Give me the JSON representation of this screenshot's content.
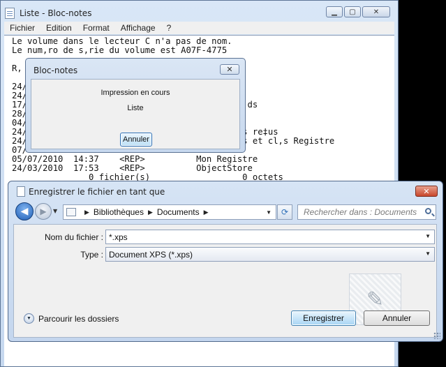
{
  "notepad": {
    "title": "Liste - Bloc-notes",
    "menu": [
      "Fichier",
      "Edition",
      "Format",
      "Affichage",
      "?"
    ],
    "content": "Le volume dans le lecteur C n'a pas de nom.\nLe num,ro de s,rie du volume est A07F-4775\n\nR,\n\n24/0\n24/0\n17/0                                          ds\n28/0\n04/0\n24/0                                     hiers re‡us\n24/0                                      ipts et cl,s Registre\n07/0\n05/07/2010  14:37    <REP>          Mon Registre\n24/03/2010  17:53    <REP>          ObjectStore\n               0 fichier(s)                  0 octets"
  },
  "print_dialog": {
    "title": "Bloc-notes",
    "status": "Impression en cours",
    "document": "Liste",
    "cancel_label": "Annuler"
  },
  "save_dialog": {
    "title": "Enregistrer le fichier en tant que",
    "breadcrumb": [
      "Bibliothèques",
      "Documents"
    ],
    "search_placeholder": "Rechercher dans : Documents",
    "filename_label": "Nom du fichier :",
    "filename_value": "*.xps",
    "type_label": "Type :",
    "type_value": "Document XPS (*.xps)",
    "browse_label": "Parcourir les dossiers",
    "save_label": "Enregistrer",
    "cancel_label": "Annuler"
  },
  "colors": {
    "title_bar": "#c6d8ef",
    "close_red": "#c8472c",
    "primary_button": "#a8d5f4"
  }
}
